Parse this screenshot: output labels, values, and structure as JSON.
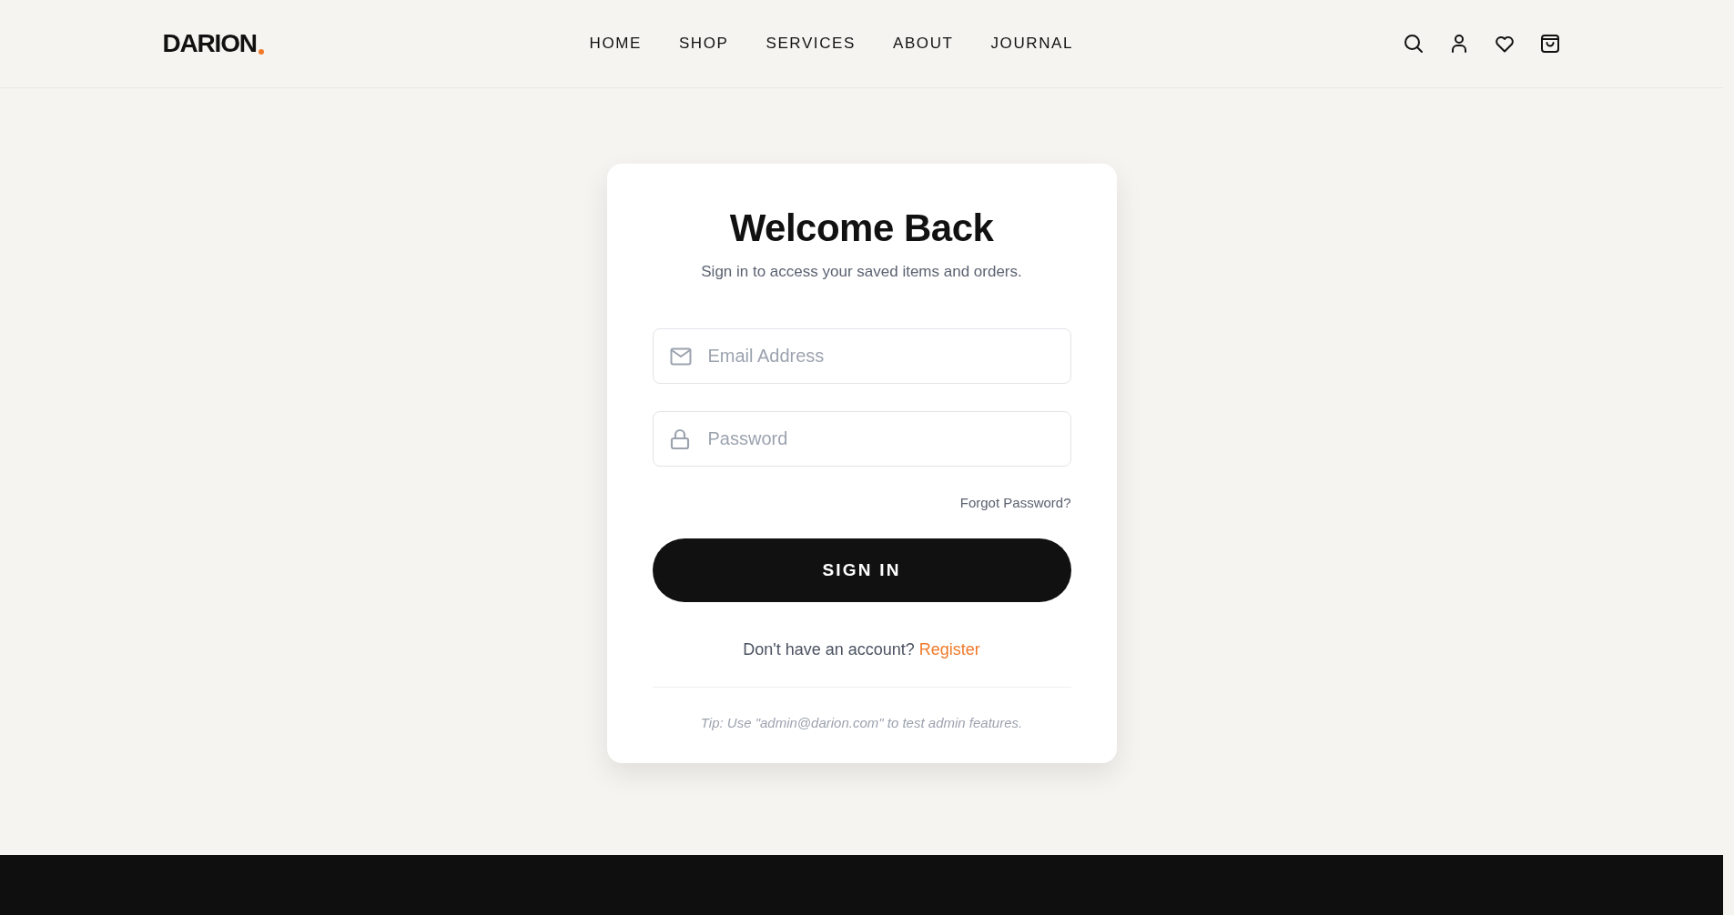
{
  "header": {
    "logo": "DARION",
    "nav": [
      {
        "label": "HOME"
      },
      {
        "label": "SHOP"
      },
      {
        "label": "SERVICES"
      },
      {
        "label": "ABOUT"
      },
      {
        "label": "JOURNAL"
      }
    ]
  },
  "login": {
    "title": "Welcome Back",
    "subtitle": "Sign in to access your saved items and orders.",
    "fields": [
      {
        "kind": "email",
        "placeholder": "Email Address"
      },
      {
        "kind": "password",
        "placeholder": "Password"
      }
    ],
    "forgot": "Forgot Password?",
    "submit": "SIGN IN",
    "register_prompt": "Don't have an account?",
    "register_link": "Register",
    "tip": "Tip: Use \"admin@darion.com\" to test admin features."
  }
}
